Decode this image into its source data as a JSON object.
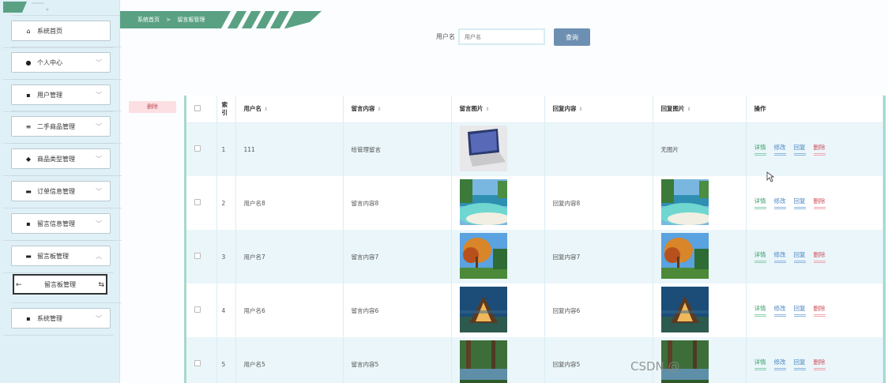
{
  "sidebar": {
    "items": [
      {
        "label": "系统首页",
        "icon": "home-icon",
        "glyph": "⌂",
        "has_chevron": false
      },
      {
        "label": "个人中心",
        "icon": "user-icon",
        "glyph": "●",
        "has_chevron": true
      },
      {
        "label": "用户管理",
        "icon": "grid-icon",
        "glyph": "▪",
        "has_chevron": true
      },
      {
        "label": "二手商品管理",
        "icon": "list-icon",
        "glyph": "≡",
        "has_chevron": true
      },
      {
        "label": "商品类型管理",
        "icon": "pin-icon",
        "glyph": "◆",
        "has_chevron": true
      },
      {
        "label": "订单信息管理",
        "icon": "chat-icon",
        "glyph": "▬",
        "has_chevron": true
      },
      {
        "label": "留言信息管理",
        "icon": "grid-icon",
        "glyph": "▪",
        "has_chevron": true
      },
      {
        "label": "留言板管理",
        "icon": "chat-icon",
        "glyph": "▬",
        "has_chevron": true,
        "expanded": true
      },
      {
        "label": "系统管理",
        "icon": "grid-icon",
        "glyph": "▪",
        "has_chevron": true
      }
    ],
    "sub_item": "留言板管理"
  },
  "breadcrumb": {
    "home": "系统首页",
    "sep": ">",
    "current": "留言板管理"
  },
  "search": {
    "label": "用户名",
    "placeholder": "用户名",
    "button": "查询"
  },
  "delete_button": "删除",
  "table": {
    "headers": [
      "索引",
      "用户名",
      "留言内容",
      "留言图片",
      "回复内容",
      "回复图片",
      "操作"
    ],
    "header_index_lines": [
      "索",
      "引"
    ],
    "rows": [
      {
        "index": "1",
        "username": "111",
        "content": "给管理留言",
        "image": "laptop",
        "reply": "",
        "reply_image": "无图片"
      },
      {
        "index": "2",
        "username": "用户名8",
        "content": "留言内容8",
        "image": "beach",
        "reply": "回复内容8",
        "reply_image": "beach"
      },
      {
        "index": "3",
        "username": "用户名7",
        "content": "留言内容7",
        "image": "autumn",
        "reply": "回复内容7",
        "reply_image": "autumn"
      },
      {
        "index": "4",
        "username": "用户名6",
        "content": "留言内容6",
        "image": "cabin",
        "reply": "回复内容6",
        "reply_image": "cabin"
      },
      {
        "index": "5",
        "username": "用户名5",
        "content": "留言内容5",
        "image": "forest",
        "reply": "回复内容5",
        "reply_image": "forest"
      }
    ],
    "actions": [
      "详情",
      "修改",
      "回复",
      "删除"
    ]
  },
  "watermark": "CSDN @",
  "colors": {
    "sidebar_bg": "#dff0f7",
    "breadcrumb_bg": "#5aa184",
    "search_button": "#6d8fb1",
    "row_alt": "#eaf6fa",
    "table_border": "#a7d8cc",
    "action_detail": "#3a9d6a",
    "action_edit": "#4b86c2",
    "action_delete": "#d0505c"
  }
}
